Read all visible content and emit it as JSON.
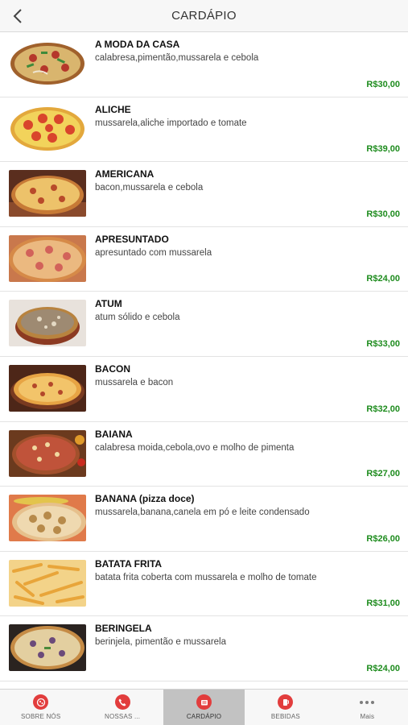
{
  "header": {
    "title": "CARDÁPIO"
  },
  "theme": {
    "price_color": "#1e8c1e",
    "accent": "#e23d3d"
  },
  "menu": [
    {
      "name": "A MODA DA CASA",
      "description": "calabresa,pimentão,mussarela e cebola",
      "price": "R$30,00"
    },
    {
      "name": "ALICHE",
      "description": "mussarela,aliche importado e tomate",
      "price": "R$39,00"
    },
    {
      "name": "AMERICANA",
      "description": "bacon,mussarela e cebola",
      "price": "R$30,00"
    },
    {
      "name": "APRESUNTADO",
      "description": "apresuntado com mussarela",
      "price": "R$24,00"
    },
    {
      "name": "ATUM",
      "description": "atum sólido e cebola",
      "price": "R$33,00"
    },
    {
      "name": "BACON",
      "description": "mussarela e bacon",
      "price": "R$32,00"
    },
    {
      "name": "BAIANA",
      "description": "calabresa moida,cebola,ovo e molho de pimenta",
      "price": "R$27,00"
    },
    {
      "name": "BANANA (pizza doce)",
      "description": "mussarela,banana,canela em pó e leite condensado",
      "price": "R$26,00"
    },
    {
      "name": "BATATA FRITA",
      "description": "batata frita coberta com mussarela e molho de tomate",
      "price": "R$31,00"
    },
    {
      "name": "BERINGELA",
      "description": "berinjela, pimentão e mussarela",
      "price": "R$24,00"
    }
  ],
  "tabs": [
    {
      "label": "SOBRE NÓS",
      "icon": "pizza-icon"
    },
    {
      "label": "NOSSAS ...",
      "icon": "phone-icon"
    },
    {
      "label": "CARDÁPIO",
      "icon": "menu-icon"
    },
    {
      "label": "BEBIDAS",
      "icon": "drink-icon"
    },
    {
      "label": "Mais",
      "icon": "more-icon"
    }
  ]
}
